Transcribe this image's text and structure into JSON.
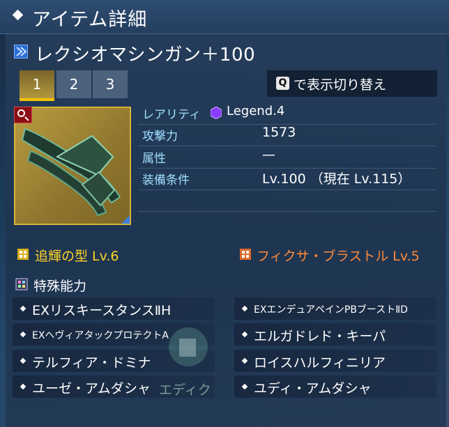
{
  "title": "アイテム詳細",
  "weapon": {
    "icon": "twin-machinegun-icon",
    "name": "レクシオマシンガン＋100"
  },
  "tabs": [
    "1",
    "2",
    "3"
  ],
  "active_tab": "1",
  "toggle": {
    "key": "Q",
    "label": "で表示切り替え"
  },
  "stats": {
    "rarity_label": "レアリティ",
    "rarity_value": "Legend.4",
    "attack_label": "攻撃力",
    "attack_value": "1573",
    "element_label": "属性",
    "element_value": "—",
    "requirement_label": "装備条件",
    "requirement_value": "Lv.100 （現在 Lv.115）"
  },
  "photon_arts": {
    "left": "追輝の型 Lv.6",
    "right": "フィクサ・ブラストル Lv.5"
  },
  "special_abilities": {
    "title": "特殊能力",
    "items": [
      "EXリスキースタンスⅡH",
      "EXエンデュアペインPBブーストⅡD",
      "EXヘヴィアタックプロテクトA",
      "エルガドレド・キーパ",
      "テルフィア・ドミナ",
      "ロイスハルフィニリア",
      "ユーゼ・アムダシャ",
      "ユディ・アムダシャ"
    ]
  },
  "overlay_text": "エディク",
  "colors": {
    "rarity_label": "#9fe0ff",
    "pa_left": "#ffd427",
    "pa_right": "#ff8a3a",
    "tab_active_underline": "#f5c400",
    "legend_gem": "#8a3cff"
  }
}
